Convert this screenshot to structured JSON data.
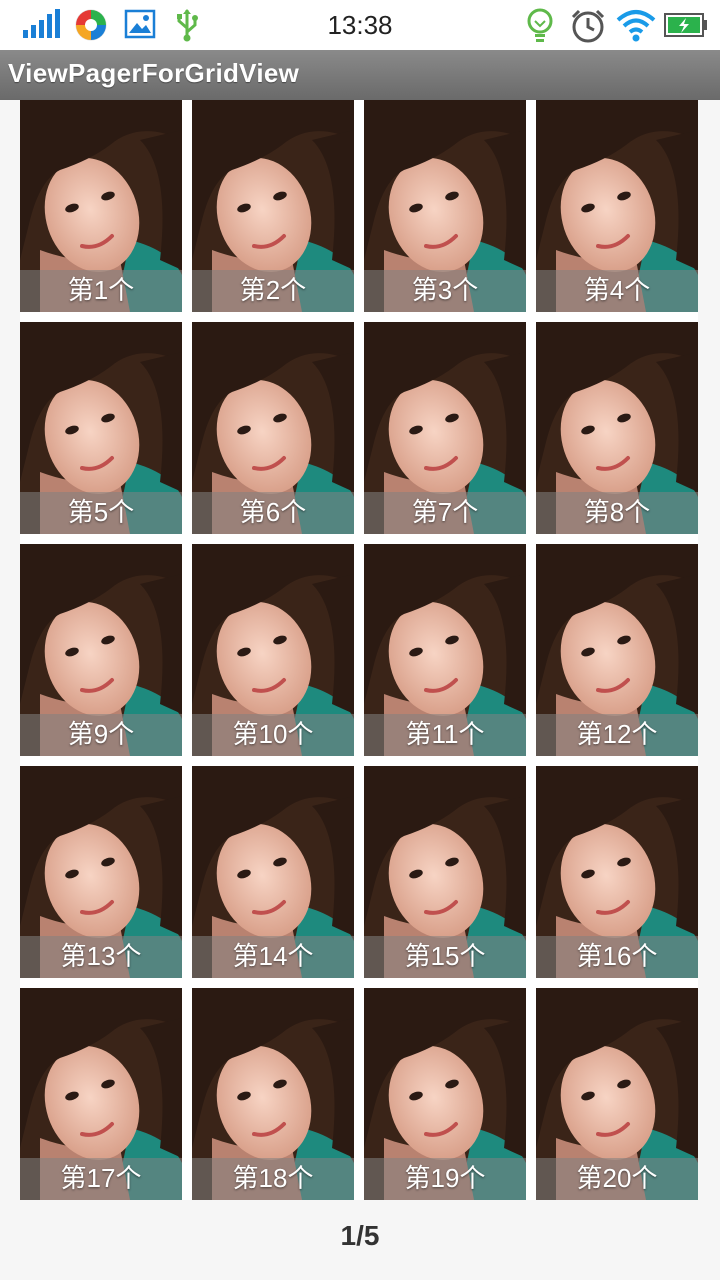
{
  "status_bar": {
    "time": "13:38",
    "left_icons": [
      "signal-bars-icon",
      "app-notification-icon",
      "image-icon",
      "usb-icon"
    ],
    "right_icons": [
      "bulb-icon",
      "alarm-clock-icon",
      "wifi-icon",
      "battery-charging-icon"
    ],
    "accent_color": "#1a7fd6"
  },
  "app_bar": {
    "title": "ViewPagerForGridView"
  },
  "grid": {
    "columns": 4,
    "items": [
      {
        "label": "第1个"
      },
      {
        "label": "第2个"
      },
      {
        "label": "第3个"
      },
      {
        "label": "第4个"
      },
      {
        "label": "第5个"
      },
      {
        "label": "第6个"
      },
      {
        "label": "第7个"
      },
      {
        "label": "第8个"
      },
      {
        "label": "第9个"
      },
      {
        "label": "第10个"
      },
      {
        "label": "第11个"
      },
      {
        "label": "第12个"
      },
      {
        "label": "第13个"
      },
      {
        "label": "第14个"
      },
      {
        "label": "第15个"
      },
      {
        "label": "第16个"
      },
      {
        "label": "第17个"
      },
      {
        "label": "第18个"
      },
      {
        "label": "第19个"
      },
      {
        "label": "第20个"
      }
    ]
  },
  "pager": {
    "indicator": "1/5"
  }
}
